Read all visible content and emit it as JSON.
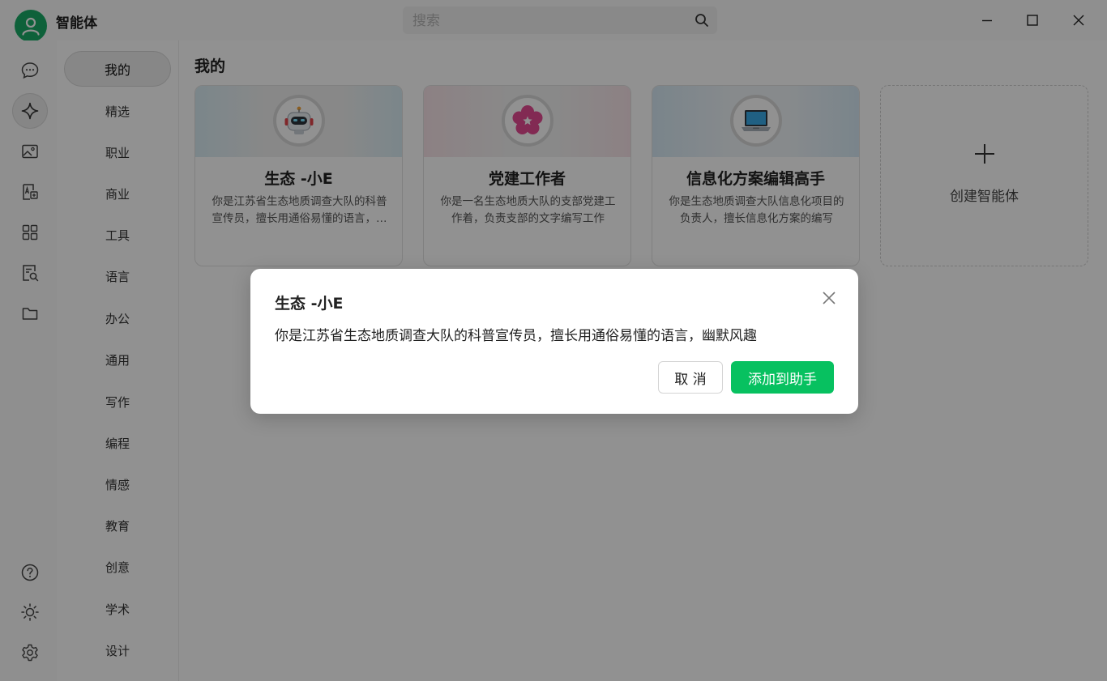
{
  "window": {
    "title": "智能体",
    "search_placeholder": "搜索",
    "search_value": ""
  },
  "rail": {
    "icons": [
      "chat-icon",
      "sparkle-icon",
      "image-icon",
      "text-image-icon",
      "apps-grid-icon",
      "doc-search-icon",
      "folder-icon",
      "help-icon",
      "brightness-icon",
      "settings-icon"
    ],
    "active": "sparkle-icon"
  },
  "categories": {
    "items": [
      "我的",
      "精选",
      "职业",
      "商业",
      "工具",
      "语言",
      "办公",
      "通用",
      "写作",
      "编程",
      "情感",
      "教育",
      "创意",
      "学术",
      "设计"
    ],
    "active": "我的"
  },
  "main": {
    "section_title": "我的",
    "cards": [
      {
        "name": "生态 -小E",
        "desc": "你是江苏省生态地质调查大队的科普宣传员，擅长用通俗易懂的语言，幽默风趣",
        "icon": "robot-icon"
      },
      {
        "name": "党建工作者",
        "desc": "你是一名生态地质大队的支部党建工作着，负责支部的文字编写工作",
        "icon": "flower-star-icon"
      },
      {
        "name": "信息化方案编辑高手",
        "desc": "你是生态地质调查大队信息化项目的负责人，擅长信息化方案的编写",
        "icon": "laptop-icon"
      }
    ],
    "create_label": "创建智能体"
  },
  "dialog": {
    "title": "生态 -小E",
    "description": "你是江苏省生态地质调查大队的科普宣传员，擅长用通俗易懂的语言，幽默风趣",
    "cancel_label": "取 消",
    "confirm_label": "添加到助手",
    "accent_color": "#07c160"
  }
}
